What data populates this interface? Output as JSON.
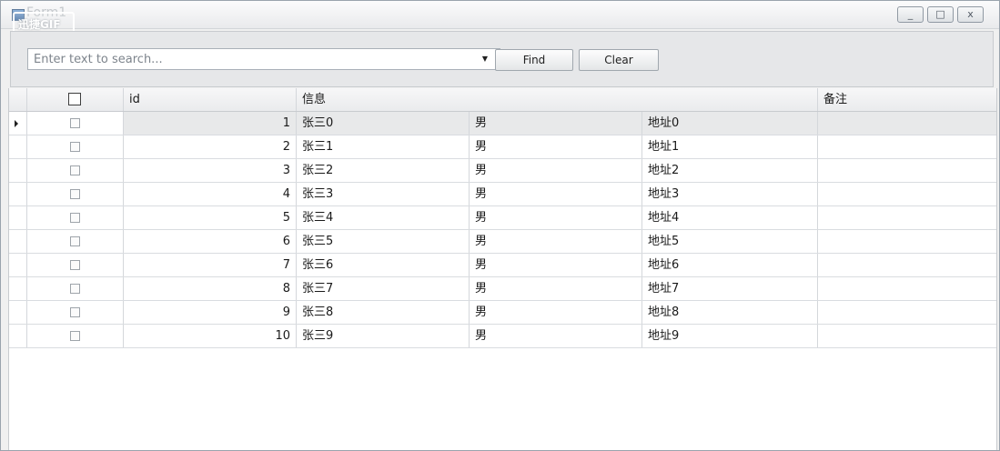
{
  "window": {
    "title": "Form1",
    "watermark": "迅捷GIF",
    "controls": {
      "minimize": "_",
      "maximize": "□",
      "close": "x"
    }
  },
  "search": {
    "placeholder": "Enter text to search...",
    "value": "",
    "find_label": "Find",
    "clear_label": "Clear"
  },
  "grid": {
    "headers": {
      "id": "id",
      "info": "信息",
      "note": "备注"
    },
    "rows": [
      {
        "id": "1",
        "name": "张三0",
        "sex": "男",
        "address": "地址0",
        "note": ""
      },
      {
        "id": "2",
        "name": "张三1",
        "sex": "男",
        "address": "地址1",
        "note": ""
      },
      {
        "id": "3",
        "name": "张三2",
        "sex": "男",
        "address": "地址2",
        "note": ""
      },
      {
        "id": "4",
        "name": "张三3",
        "sex": "男",
        "address": "地址3",
        "note": ""
      },
      {
        "id": "5",
        "name": "张三4",
        "sex": "男",
        "address": "地址4",
        "note": ""
      },
      {
        "id": "6",
        "name": "张三5",
        "sex": "男",
        "address": "地址5",
        "note": ""
      },
      {
        "id": "7",
        "name": "张三6",
        "sex": "男",
        "address": "地址6",
        "note": ""
      },
      {
        "id": "8",
        "name": "张三7",
        "sex": "男",
        "address": "地址7",
        "note": ""
      },
      {
        "id": "9",
        "name": "张三8",
        "sex": "男",
        "address": "地址8",
        "note": ""
      },
      {
        "id": "10",
        "name": "张三9",
        "sex": "男",
        "address": "地址9",
        "note": ""
      }
    ]
  },
  "colors": {
    "window_border": "#9aa3ad",
    "panel_bg": "#e6e7e9",
    "focused_row": "#e8e9ea"
  }
}
